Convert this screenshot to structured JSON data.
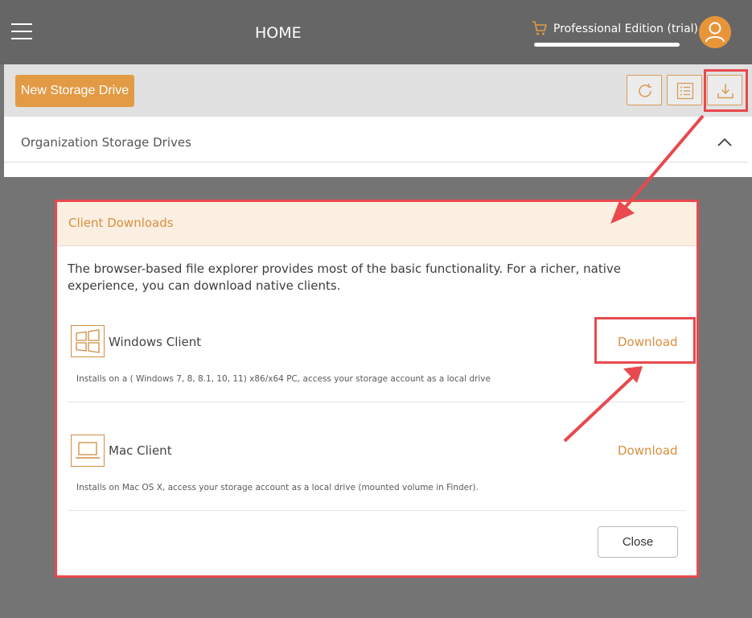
{
  "header": {
    "title": "HOME",
    "edition_label": "Professional Edition (trial)",
    "menu_icon": "hamburger-menu-icon",
    "cart_icon": "shopping-cart-icon",
    "avatar_icon": "user-avatar-icon"
  },
  "toolbar": {
    "new_drive_label": "New Storage Drive",
    "buttons": [
      "refresh-icon",
      "list-view-icon",
      "download-icon"
    ]
  },
  "drives_section": {
    "title": "Organization Storage Drives"
  },
  "modal": {
    "title": "Client Downloads",
    "description": "The browser-based file explorer provides most of the basic functionality. For a richer, native experience, you can download native clients.",
    "clients": [
      {
        "name": "Windows Client",
        "icon": "windows-icon",
        "description": "Installs on a ( Windows 7, 8, 8.1, 10, 11) x86/x64 PC, access your storage account as a local drive",
        "action": "Download"
      },
      {
        "name": "Mac Client",
        "icon": "laptop-icon",
        "description": "Installs on Mac OS X, access your storage account as a local drive (mounted volume in Finder).",
        "action": "Download"
      }
    ],
    "close_label": "Close"
  },
  "colors": {
    "accent": "#e39a45",
    "highlight": "#e8494e",
    "header_bg": "#666666"
  }
}
